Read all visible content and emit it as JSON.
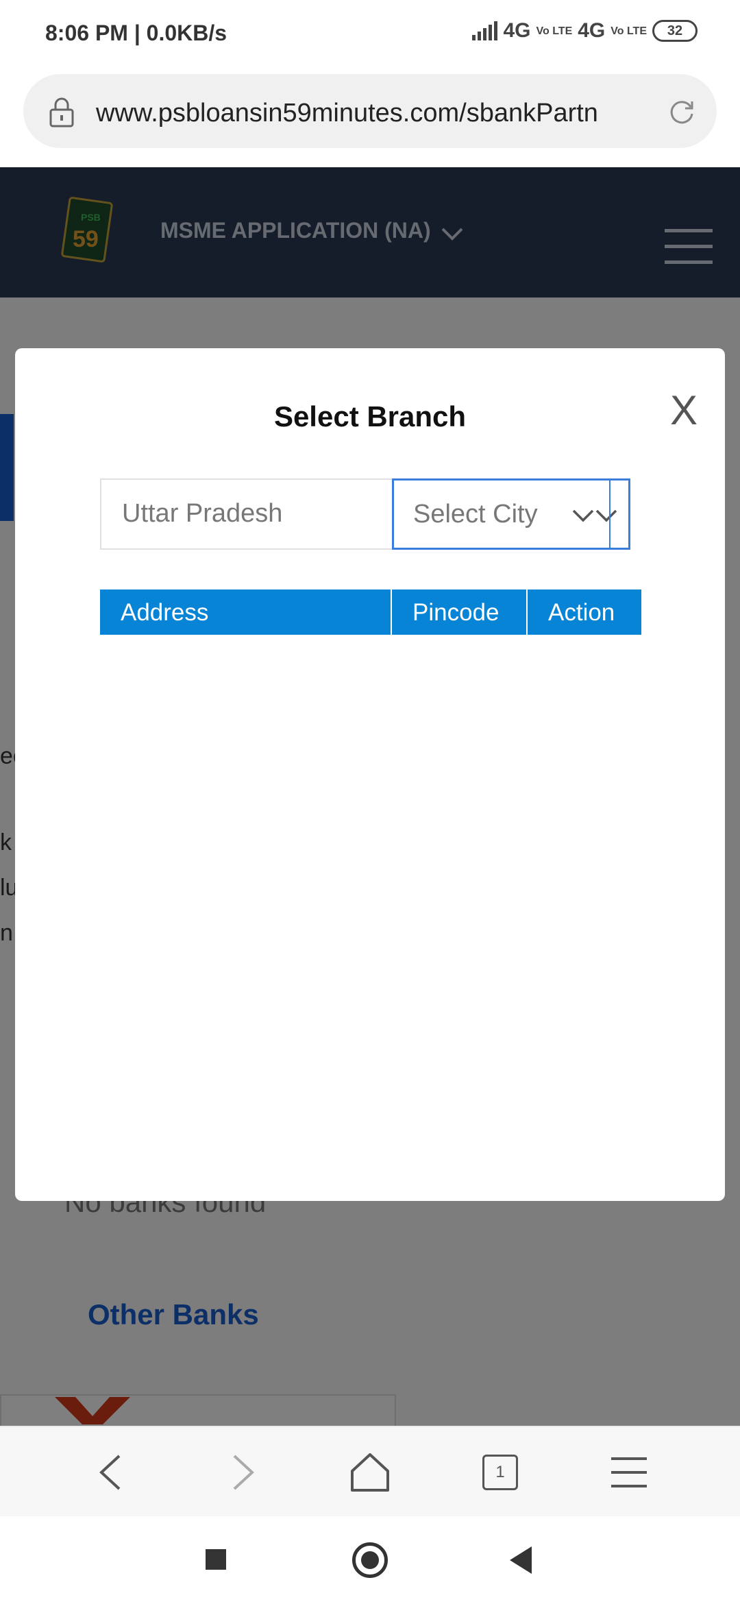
{
  "status_bar": {
    "time": "8:06 PM | 0.0KB/s",
    "network_1": "4G",
    "network_2": "4G",
    "volte": "Vo LTE",
    "battery": "32"
  },
  "browser": {
    "url": "www.psbloansin59minutes.com/sbankPartn"
  },
  "background_page": {
    "logo_top": "PSB",
    "logo_number": "59",
    "app_name": "MSME APPLICATION (NA)",
    "partial_lines": [
      "ec",
      "k",
      "lu",
      "n"
    ],
    "no_banks": "No banks found",
    "other_banks": "Other Banks"
  },
  "modal": {
    "title": "Select Branch",
    "close_label": "X",
    "state_value": "Uttar Pradesh",
    "city_placeholder": "Select City",
    "table_headers": {
      "address": "Address",
      "pincode": "Pincode",
      "action": "Action"
    }
  },
  "browser_toolbar": {
    "tab_count": "1"
  },
  "colors": {
    "table_header": "#0784d6",
    "select_border": "#3b7ddd",
    "overlay": "rgba(0,0,0,0.5)"
  }
}
